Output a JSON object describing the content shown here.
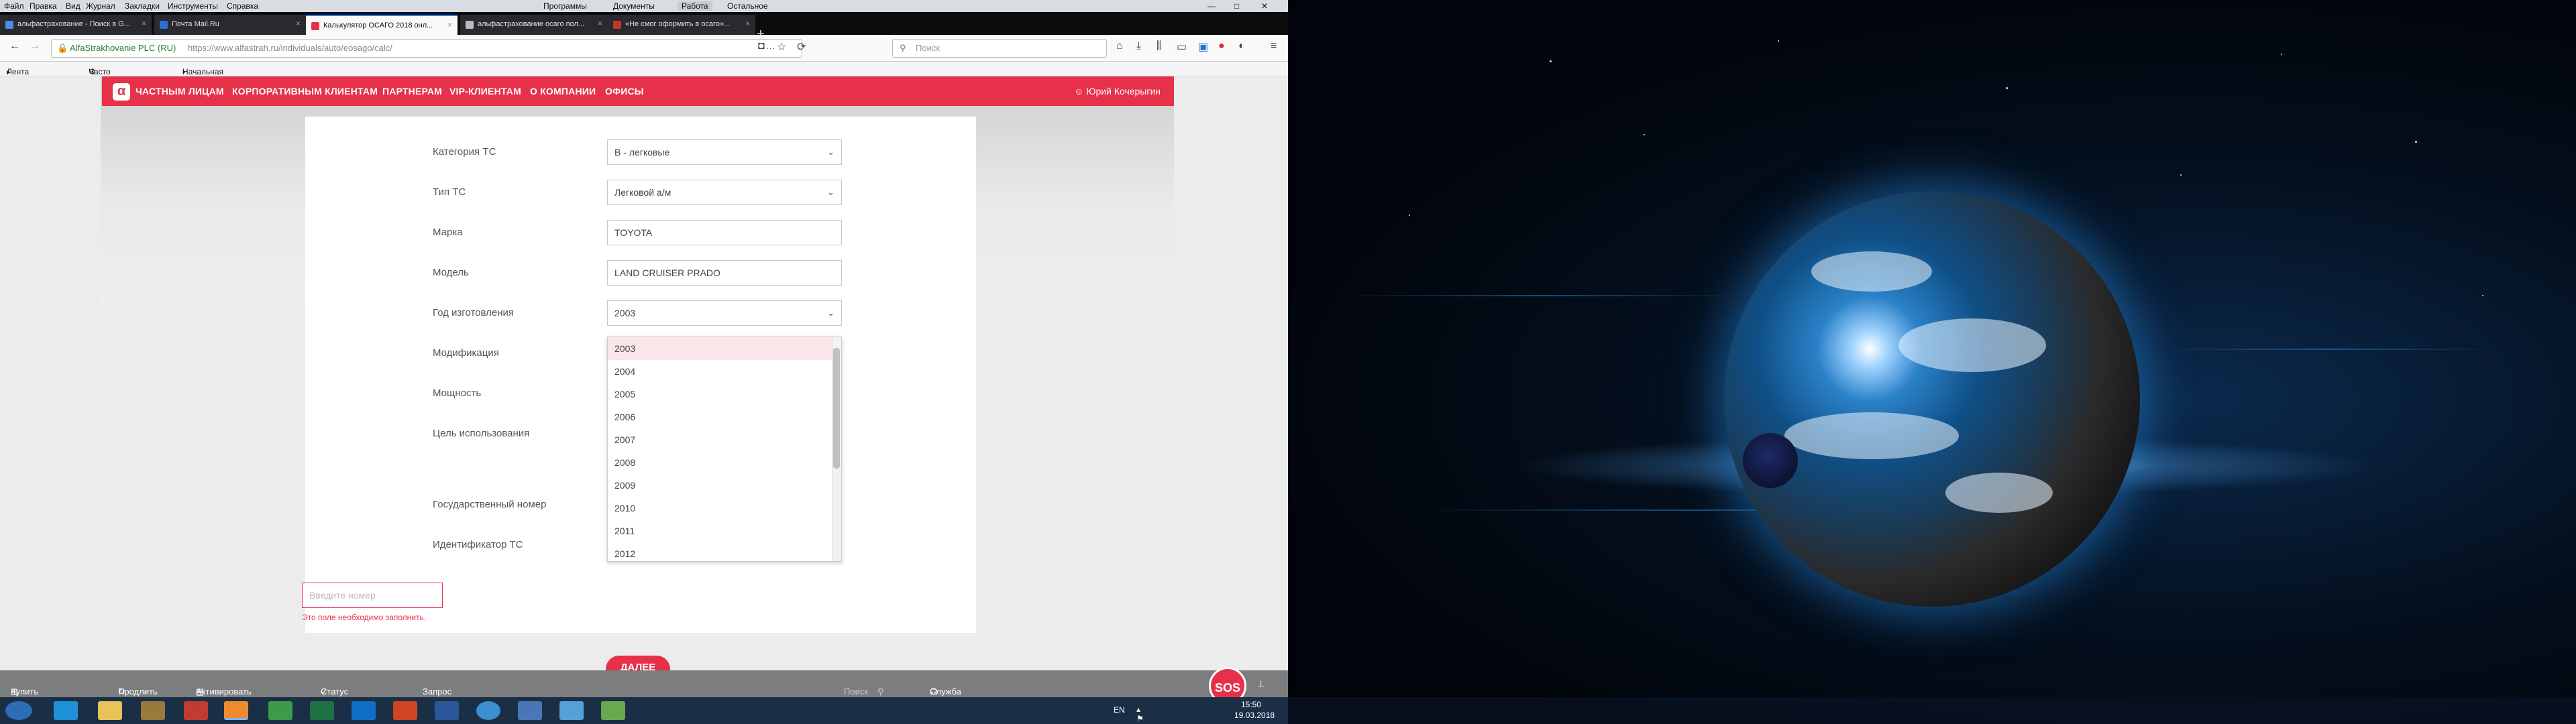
{
  "browser": {
    "menu": [
      "Файл",
      "Правка",
      "Вид",
      "Журнал",
      "Закладки",
      "Инструменты",
      "Справка"
    ],
    "title_tabs": [
      "Программы",
      "Документы",
      "Работа",
      "Остальное"
    ],
    "tabs": [
      {
        "label": "альфастрахование - Поиск в G..."
      },
      {
        "label": "Почта Mail.Ru"
      },
      {
        "label": "Калькулятор ОСАГО 2018 онл..."
      },
      {
        "label": "альфастрахование осаго пол..."
      },
      {
        "label": "«Не смог оформить в осаго»..."
      }
    ],
    "site_identity": "AlfaStrakhovanie PLC (RU)",
    "url": "https://www.alfastrah.ru/individuals/auto/eosago/calc/",
    "search_placeholder": "Поиск",
    "bookmarks": [
      "Лента новостей",
      "Часто посещаемые",
      "Начальная страница"
    ]
  },
  "site": {
    "logo_letter": "α",
    "nav": [
      "ЧАСТНЫМ ЛИЦАМ",
      "КОРПОРАТИВНЫМ КЛИЕНТАМ",
      "ПАРТНЕРАМ",
      "VIP-КЛИЕНТАМ",
      "О КОМПАНИИ",
      "ОФИСЫ"
    ],
    "user": "Юрий Кочерыгин"
  },
  "form": {
    "fields": [
      {
        "label": "Категория ТС",
        "value": "B - легковые"
      },
      {
        "label": "Тип ТС",
        "value": "Легковой а/м"
      },
      {
        "label": "Марка",
        "value": "TOYOTA"
      },
      {
        "label": "Модель",
        "value": "LAND CRUISER PRADO"
      },
      {
        "label": "Год изготовления",
        "value": "2003"
      },
      {
        "label": "Модификация",
        "value": ""
      },
      {
        "label": "Мощность",
        "value": ""
      },
      {
        "label": "Цель использования",
        "value": ""
      },
      {
        "label": "Государственный номер",
        "value": ""
      },
      {
        "label": "Идентификатор ТС",
        "value": ""
      }
    ],
    "year_options": [
      "2003",
      "2004",
      "2005",
      "2006",
      "2007",
      "2008",
      "2009",
      "2010",
      "2011",
      "2012"
    ],
    "selected_year": "2003",
    "regnum_placeholder": "Введите номер",
    "error_text": "Это поле необходимо заполнить.",
    "next_label": "ДАЛЕЕ"
  },
  "page_footer": {
    "items": [
      "Купить продукт",
      "Продлить",
      "Активировать полис",
      "Статус события",
      "Запрос по КБМ"
    ],
    "search_placeholder": "Поиск",
    "quality": "Служба качества",
    "sos": "SOS"
  },
  "tray": {
    "lang": "EN",
    "time": "15:50",
    "date": "19.03.2018"
  }
}
